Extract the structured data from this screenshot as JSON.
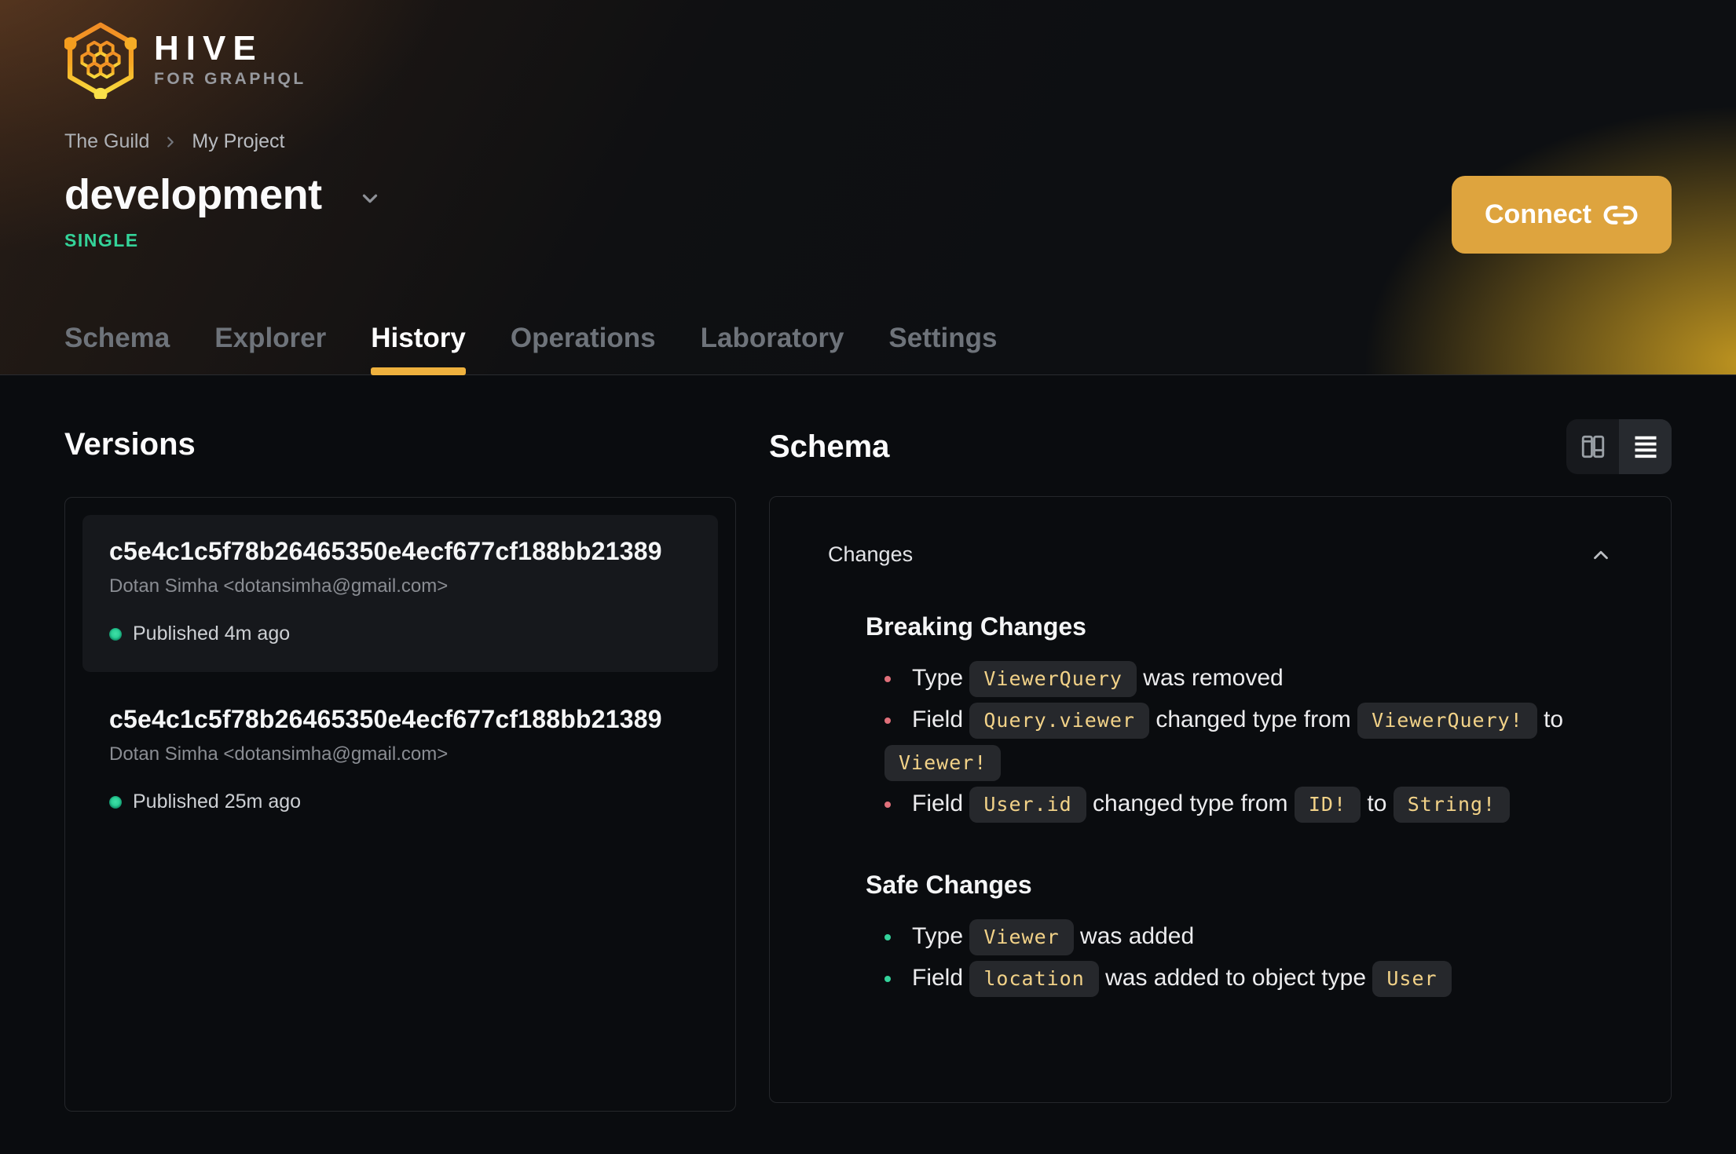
{
  "brand": {
    "name": "HIVE",
    "tagline": "FOR GRAPHQL"
  },
  "breadcrumb": {
    "org": "The Guild",
    "project": "My Project"
  },
  "target": {
    "name": "development",
    "badge": "SINGLE"
  },
  "connect": {
    "label": "Connect"
  },
  "tabs": [
    {
      "label": "Schema",
      "active": false
    },
    {
      "label": "Explorer",
      "active": false
    },
    {
      "label": "History",
      "active": true
    },
    {
      "label": "Operations",
      "active": false
    },
    {
      "label": "Laboratory",
      "active": false
    },
    {
      "label": "Settings",
      "active": false
    }
  ],
  "versions": {
    "title": "Versions",
    "items": [
      {
        "hash": "c5e4c1c5f78b26465350e4ecf677cf188bb21389",
        "author": "Dotan Simha <dotansimha@gmail.com>",
        "status": "Published 4m ago",
        "selected": true
      },
      {
        "hash": "c5e4c1c5f78b26465350e4ecf677cf188bb21389",
        "author": "Dotan Simha <dotansimha@gmail.com>",
        "status": "Published 25m ago",
        "selected": false
      }
    ]
  },
  "schema": {
    "title": "Schema",
    "changes_label": "Changes",
    "view_toggle": [
      {
        "name": "columns-view",
        "active": false
      },
      {
        "name": "list-view",
        "active": true
      }
    ],
    "breaking": {
      "title": "Breaking Changes",
      "items": [
        [
          {
            "t": "text",
            "v": "Type "
          },
          {
            "t": "code",
            "v": "ViewerQuery"
          },
          {
            "t": "text",
            "v": " was removed"
          }
        ],
        [
          {
            "t": "text",
            "v": "Field "
          },
          {
            "t": "code",
            "v": "Query.viewer"
          },
          {
            "t": "text",
            "v": " changed type from "
          },
          {
            "t": "code",
            "v": "ViewerQuery!"
          },
          {
            "t": "text",
            "v": " to "
          },
          {
            "t": "code",
            "v": "Viewer!"
          }
        ],
        [
          {
            "t": "text",
            "v": "Field "
          },
          {
            "t": "code",
            "v": "User.id"
          },
          {
            "t": "text",
            "v": " changed type from "
          },
          {
            "t": "code",
            "v": "ID!"
          },
          {
            "t": "text",
            "v": " to "
          },
          {
            "t": "code",
            "v": "String!"
          }
        ]
      ]
    },
    "safe": {
      "title": "Safe Changes",
      "items": [
        [
          {
            "t": "text",
            "v": "Type "
          },
          {
            "t": "code",
            "v": "Viewer"
          },
          {
            "t": "text",
            "v": " was added"
          }
        ],
        [
          {
            "t": "text",
            "v": "Field "
          },
          {
            "t": "code",
            "v": "location"
          },
          {
            "t": "text",
            "v": " was added to object type "
          },
          {
            "t": "code",
            "v": "User"
          }
        ]
      ]
    }
  },
  "icons": {
    "logo": "hive-honeycomb-hexagon",
    "breadcrumb_separator": "chevron-right",
    "target_dropdown": "chevron-down",
    "connect": "link-chain",
    "view_columns": "split-columns",
    "view_list": "horizontal-lines",
    "changes_collapse": "chevron-up",
    "published": "green-dot"
  },
  "colors": {
    "background": "#0a0c0f",
    "accent_amber": "#eeb13e",
    "connect_button": "#dea43e",
    "badge_green": "#34d399",
    "status_dot_green": "#2bd097",
    "breaking_bullet": "#e0707a",
    "safe_bullet": "#34d39b",
    "chip_bg": "#26282c",
    "chip_text": "#f2d288",
    "panel_border": "#25272b",
    "selected_card_bg": "#16181c"
  }
}
